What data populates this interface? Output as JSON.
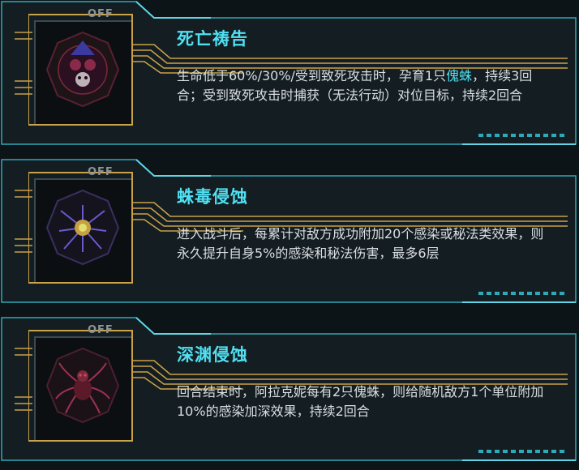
{
  "skills": [
    {
      "title": "死亡祷告",
      "toggle": "OFF",
      "icon": "skull-flower-icon",
      "desc_before": "生命低于60%/30%/受到致死攻击时，孕育1只",
      "desc_highlight": "傀蛛",
      "desc_after": "，持续3回合；受到致死攻击时捕获（无法行动）对位目标，持续2回合"
    },
    {
      "title": "蛛毒侵蚀",
      "toggle": "OFF",
      "icon": "spider-venom-icon",
      "desc": "进入战斗后，每累计对敌方成功附加20个感染或秘法类效果，则永久提升自身5%的感染和秘法伤害，最多6层"
    },
    {
      "title": "深渊侵蚀",
      "toggle": "OFF",
      "icon": "abyss-spider-icon",
      "desc": "回合结束时，阿拉克妮每有2只傀蛛，则给随机敌方1个单位附加10%的感染加深效果，持续2回合"
    }
  ],
  "colors": {
    "accent": "#4fe0f2",
    "gold": "#c9a24a",
    "border": "#2fa8b8",
    "panel": "#141d21"
  }
}
